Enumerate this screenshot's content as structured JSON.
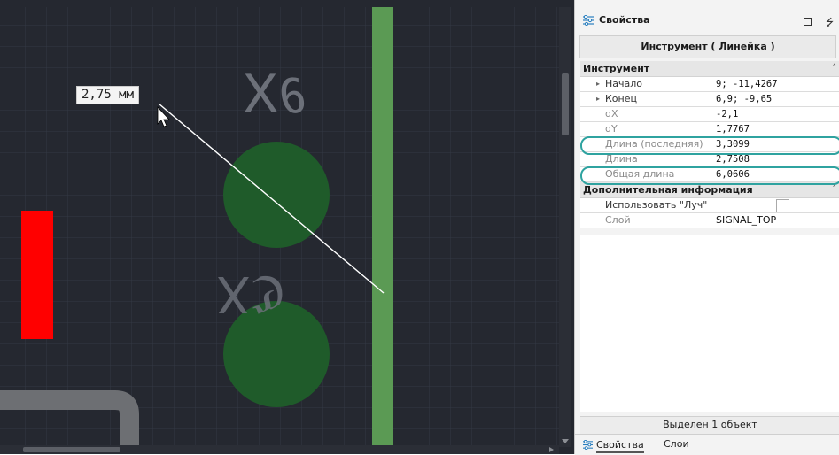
{
  "canvas": {
    "measure_label": "2,75 мм",
    "silk_top": "∂X",
    "silk_mid": "ℭX",
    "colors": {
      "background": "#252830",
      "pad": "#215a2a",
      "trace": "#5b9a54",
      "red_pad": "#ff0000",
      "grid": "#353a44"
    }
  },
  "panel": {
    "title": "Свойства",
    "tool_header": "Инструмент ( Линейка )",
    "categories": [
      {
        "label": "Инструмент",
        "rows": [
          {
            "name": "Начало",
            "value": "9; -11,4267"
          },
          {
            "name": "Конец",
            "value": "6,9; -9,65"
          },
          {
            "name": "dX",
            "value": "-2,1"
          },
          {
            "name": "dY",
            "value": "1,7767"
          },
          {
            "name": "Длина (последняя)",
            "value": "3,3099"
          },
          {
            "name": "Длина",
            "value": "2,7508"
          },
          {
            "name": "Общая длина",
            "value": "6,0606"
          }
        ]
      },
      {
        "label": "Дополнительная информация",
        "rows": [
          {
            "name": "Использовать \"Луч\"",
            "value": ""
          },
          {
            "name": "Слой",
            "value": "SIGNAL_TOP"
          }
        ]
      }
    ],
    "status": "Выделен 1 объект",
    "tabs": {
      "properties": "Свойства",
      "layers": "Слои"
    },
    "highlight_color": "#2fa3a0"
  }
}
